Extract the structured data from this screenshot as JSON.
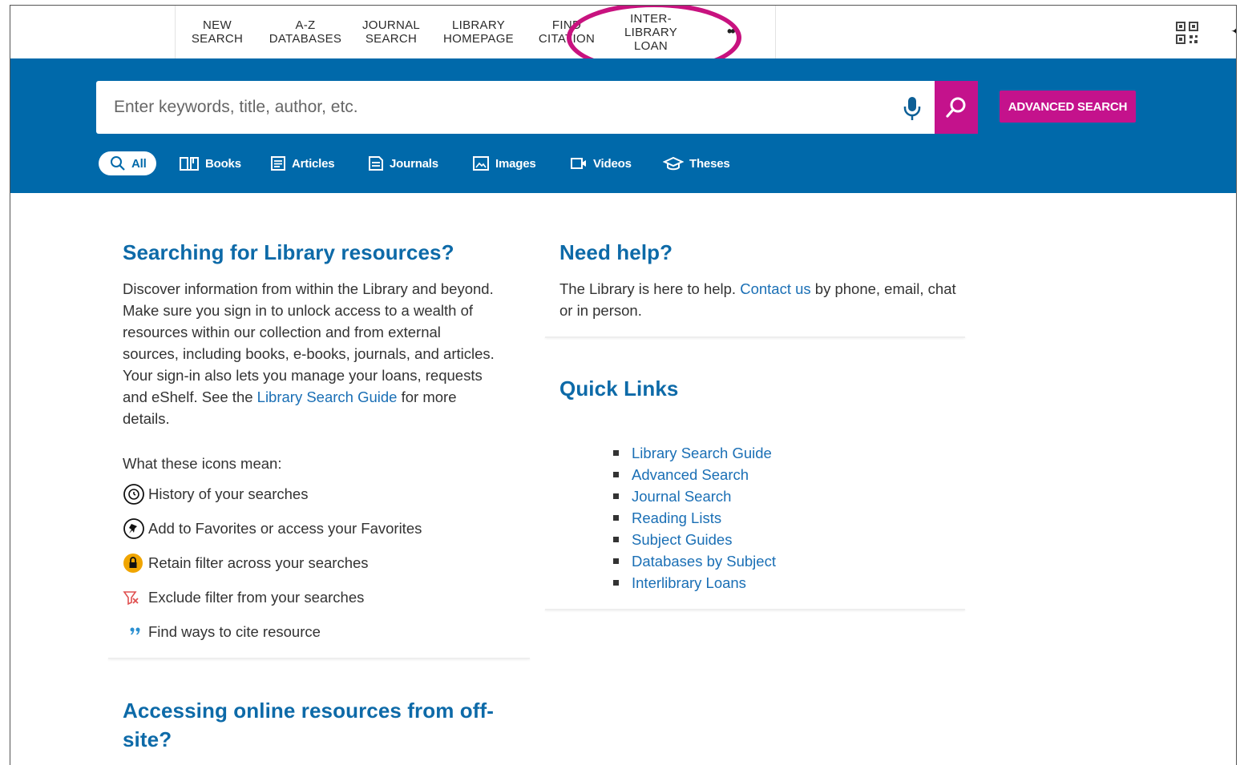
{
  "nav": {
    "items": [
      {
        "label": "NEW\nSEARCH"
      },
      {
        "label": "A-Z\nDATABASES"
      },
      {
        "label": "JOURNAL\nSEARCH"
      },
      {
        "label": "LIBRARY\nHOMEPAGE"
      },
      {
        "label": "FIND\nCITATION"
      },
      {
        "label": "INTER-\nLIBRARY\nLOAN"
      }
    ],
    "more_label": "••"
  },
  "search": {
    "placeholder": "Enter keywords, title, author, etc.",
    "advanced_label": "ADVANCED SEARCH"
  },
  "filters": [
    {
      "label": "All"
    },
    {
      "label": "Books"
    },
    {
      "label": "Articles"
    },
    {
      "label": "Journals"
    },
    {
      "label": "Images"
    },
    {
      "label": "Videos"
    },
    {
      "label": "Theses"
    }
  ],
  "resources": {
    "title": "Searching for Library resources?",
    "body_before": "Discover information from within the Library and beyond. Make sure you sign in to unlock access to a wealth of resources within our collection and from external sources, including books, e-books, journals, and articles. Your sign-in also lets you manage your loans, requests and eShelf. See the ",
    "body_link": "Library Search Guide",
    "body_after": " for more details.",
    "icons_heading": "What these icons mean:",
    "icons": [
      {
        "icon": "history-icon",
        "text": "History of your searches"
      },
      {
        "icon": "pin-icon",
        "text": "Add to Favorites or access your Favorites"
      },
      {
        "icon": "lock-icon",
        "text": "Retain filter across your searches"
      },
      {
        "icon": "exclude-icon",
        "text": "Exclude filter from your searches"
      },
      {
        "icon": "quote-icon",
        "text": "Find ways to cite resource"
      }
    ]
  },
  "help": {
    "title": "Need help?",
    "before": "The Library is here to help. ",
    "link": "Contact us",
    "after": " by phone, email, chat or in person."
  },
  "quick_links": {
    "title": "Quick Links",
    "items": [
      "Library Search Guide",
      "Advanced Search",
      "Journal Search",
      "Reading Lists",
      "Subject Guides",
      "Databases by Subject",
      "Interlibrary Loans"
    ]
  },
  "offsite": {
    "title": "Accessing online resources from off-site?"
  },
  "colors": {
    "brand_blue": "#0069aa",
    "accent_magenta": "#c4128c",
    "highlight_ring": "#c8127f",
    "link": "#1a6fb5"
  }
}
